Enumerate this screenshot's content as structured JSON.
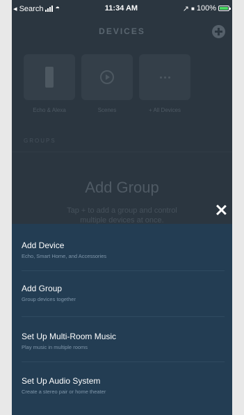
{
  "status_bar": {
    "back_label": "◂ Search",
    "time": "11:34 AM",
    "battery": "100%"
  },
  "header": {
    "title": "DEVICES"
  },
  "tiles": [
    {
      "label": "Echo & Alexa",
      "icon": "echo-icon"
    },
    {
      "label": "Scenes",
      "icon": "play-circle-icon"
    },
    {
      "label": "All Devices",
      "icon": "more-dots-icon"
    }
  ],
  "groups": {
    "section_label": "GROUPS",
    "empty_title": "Add Group",
    "empty_subtitle": "Tap + to add a group and control multiple devices at once."
  },
  "menu": [
    {
      "title": "Add Device",
      "subtitle": "Echo, Smart Home, and Accessories"
    },
    {
      "title": "Add Group",
      "subtitle": "Group devices together"
    },
    {
      "title": "Set Up Multi-Room Music",
      "subtitle": "Play music in multiple rooms"
    },
    {
      "title": "Set Up Audio System",
      "subtitle": "Create a stereo pair or home theater"
    }
  ],
  "colors": {
    "background": "#2b3640",
    "sheet": "#233d53",
    "battery_green": "#4cd964"
  }
}
